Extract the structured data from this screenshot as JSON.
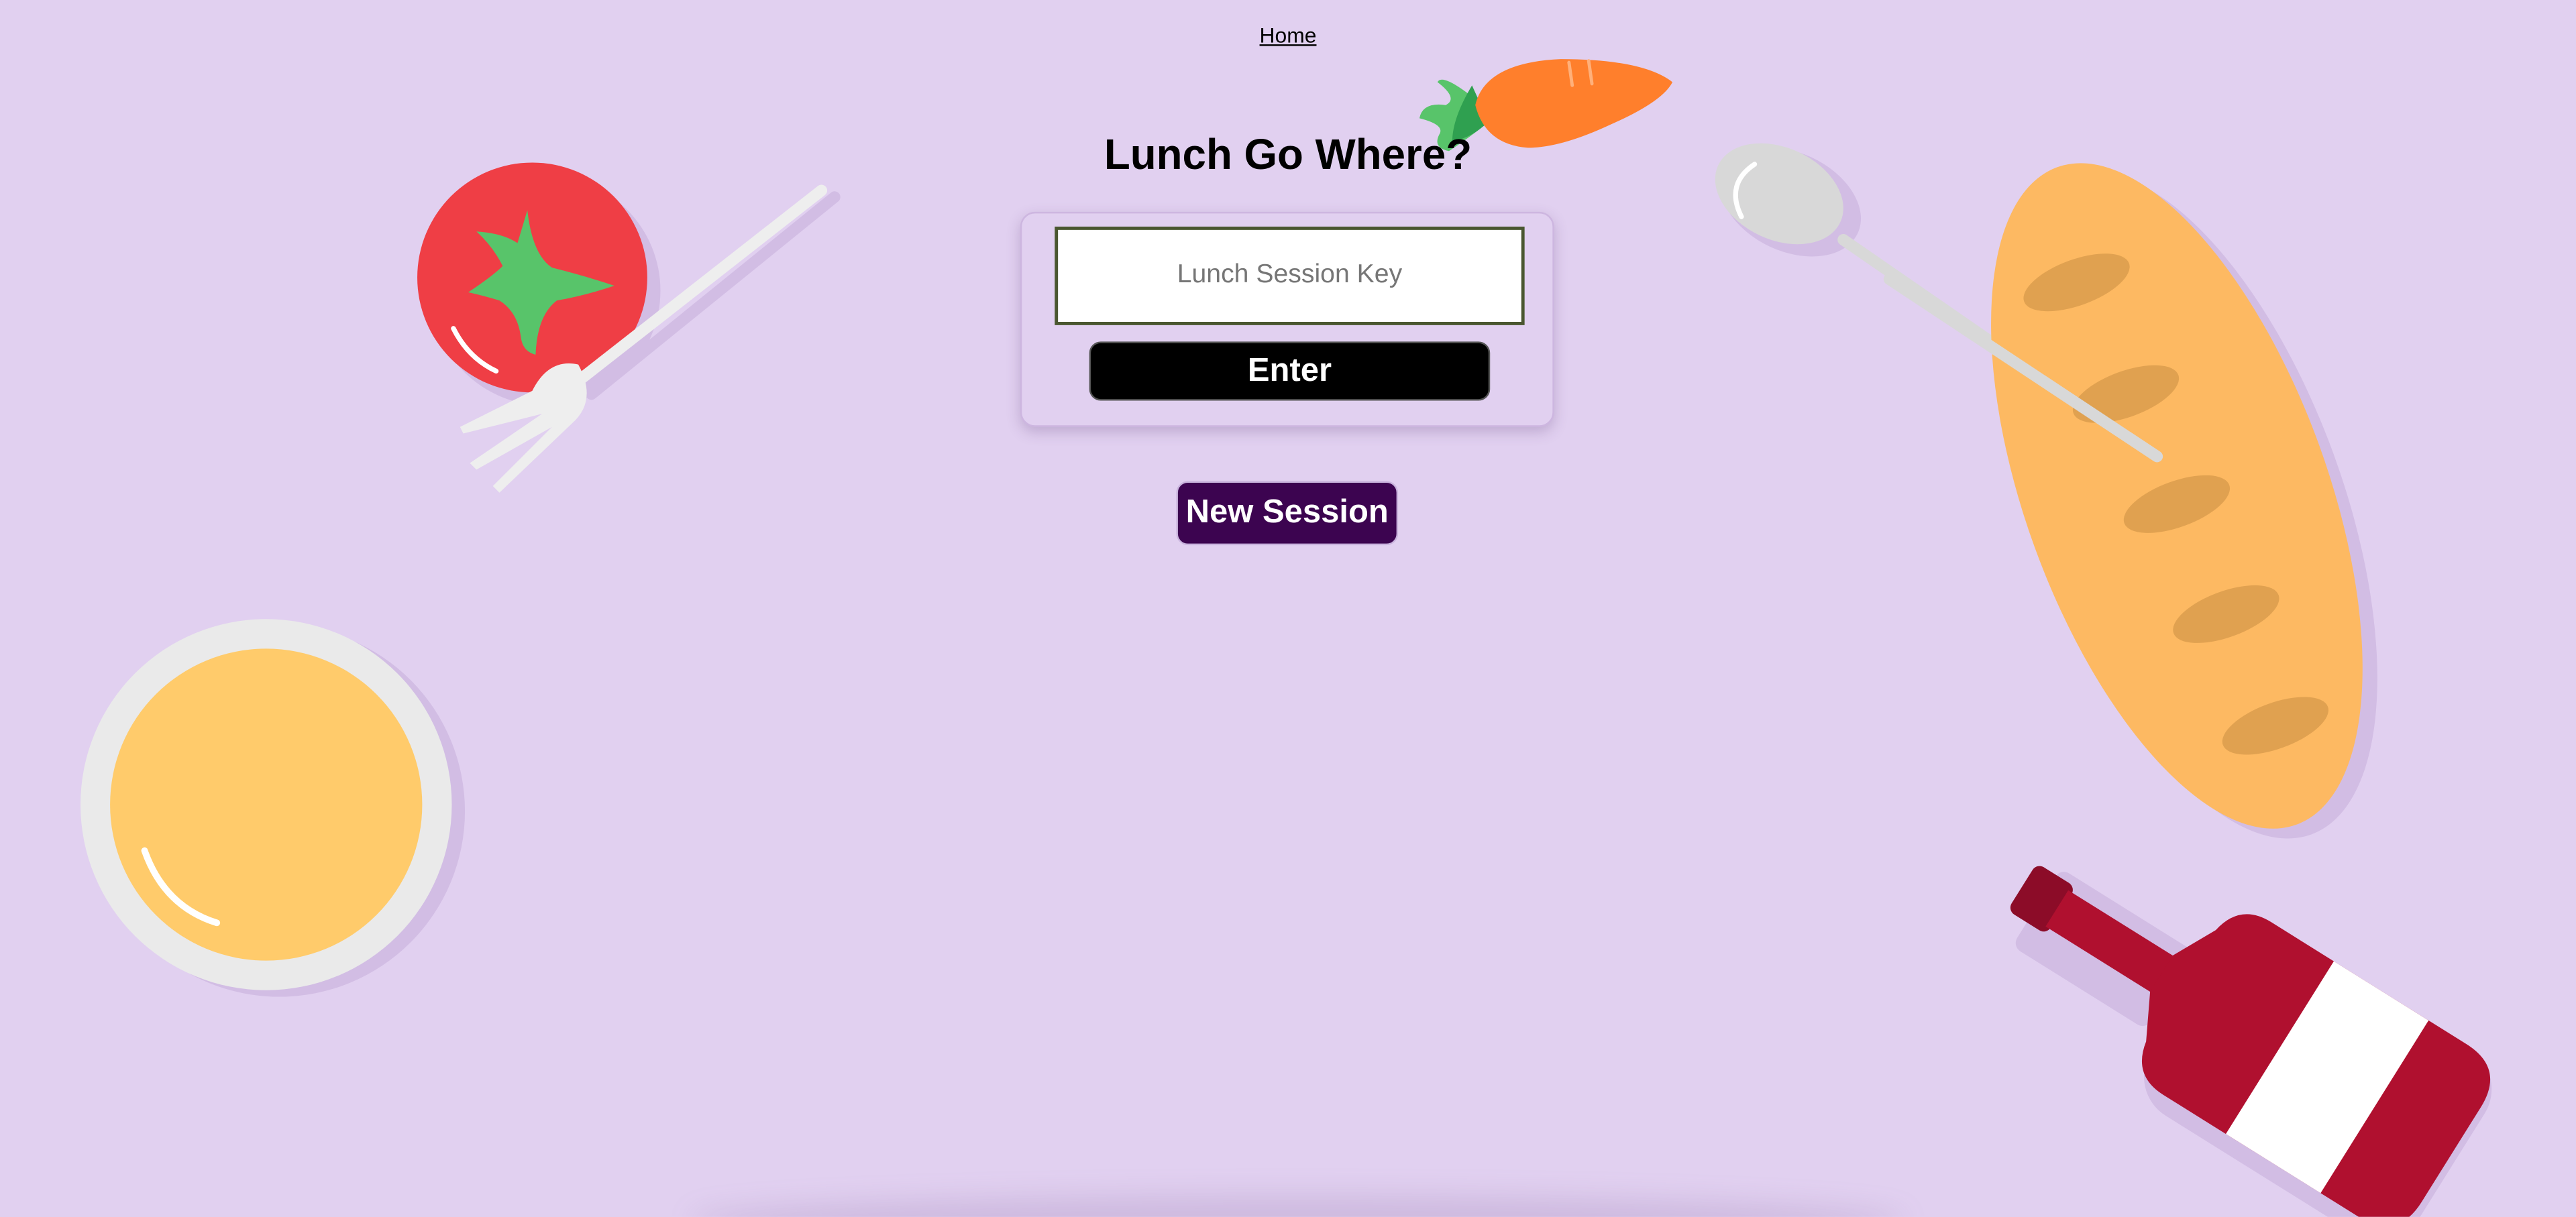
{
  "nav": {
    "home_label": "Home"
  },
  "title": "Lunch Go Where?",
  "session_form": {
    "key_placeholder": "Lunch Session Key",
    "key_value": "",
    "enter_label": "Enter"
  },
  "new_session_label": "New Session",
  "decorations": [
    "tomato-icon",
    "fork-icon",
    "carrot-icon",
    "spoon-icon",
    "baguette-icon",
    "plate-icon",
    "wine-bottle-icon"
  ],
  "colors": {
    "background": "#e1d0f0",
    "enter_button": "#000000",
    "new_session_button": "#3c0450",
    "tomato": "#ef3e45",
    "leaf": "#58c46a",
    "carrot": "#ff7f2c",
    "bread": "#fdb962",
    "plate_food": "#ffcb6b",
    "wine": "#b0102f"
  }
}
